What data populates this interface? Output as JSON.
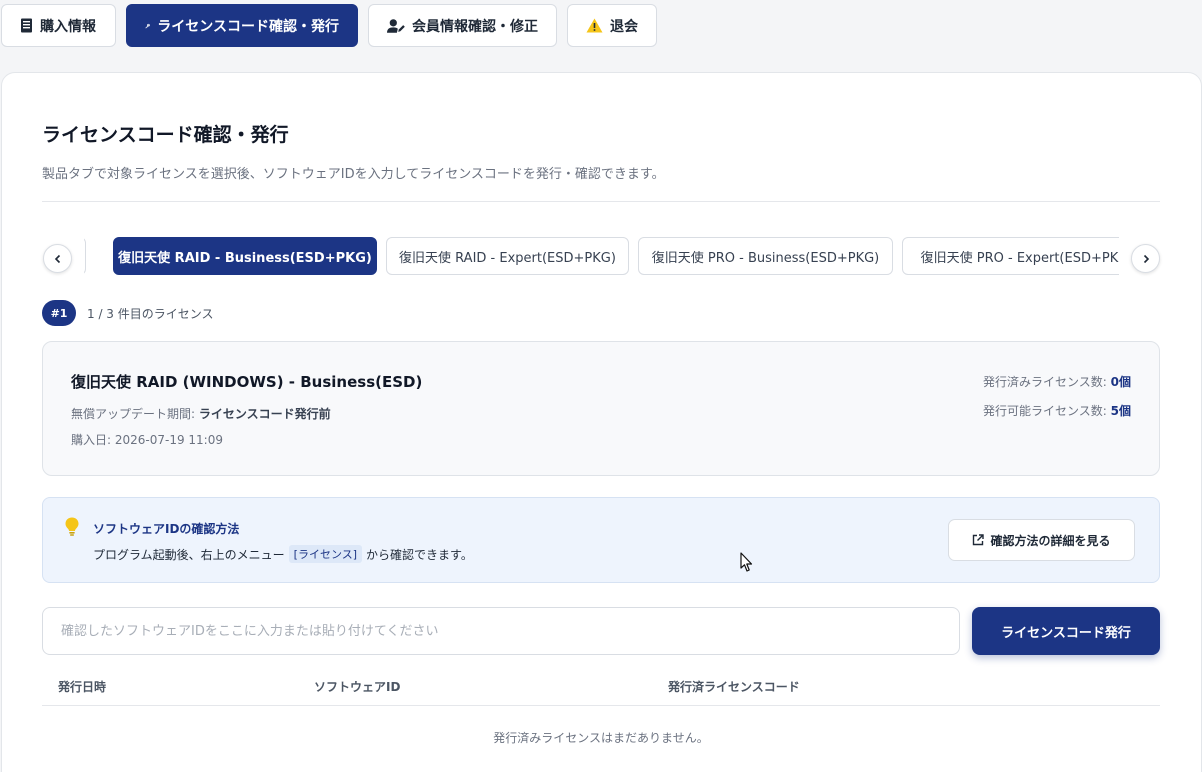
{
  "nav": {
    "tabs": [
      {
        "label": "購入情報",
        "icon": "receipt-icon",
        "active": false
      },
      {
        "label": "ライセンスコード確認・発行",
        "icon": "key-icon",
        "active": true
      },
      {
        "label": "会員情報確認・修正",
        "icon": "user-edit-icon",
        "active": false
      },
      {
        "label": "退会",
        "icon": "warning-icon",
        "active": false
      }
    ]
  },
  "page": {
    "title": "ライセンスコード確認・発行",
    "description": "製品タブで対象ライセンスを選択後、ソフトウェアIDを入力してライセンスコードを発行・確認できます。"
  },
  "product_tabs": [
    {
      "label": "復旧天使 RAID - Business(ESD+PKG)",
      "active": true
    },
    {
      "label": "復旧天使 RAID - Expert(ESD+PKG)",
      "active": false
    },
    {
      "label": "復旧天使 PRO - Business(ESD+PKG)",
      "active": false
    },
    {
      "label": "復旧天使 PRO - Expert(ESD+PKG)",
      "active": false
    }
  ],
  "license_index": {
    "badge": "#1",
    "text": "1 / 3 件目のライセンス"
  },
  "license": {
    "name": "復旧天使 RAID (WINDOWS) - Business(ESD)",
    "update_label": "無償アップデート期間: ",
    "update_value": "ライセンスコード発行前",
    "purchase_date": "購入日: 2026-07-19 11:09",
    "issued_label": "発行済みライセンス数: ",
    "issued_value": "0個",
    "available_label": "発行可能ライセンス数: ",
    "available_value": "5個"
  },
  "hint": {
    "title": "ソフトウェアIDの確認方法",
    "text_before": "プログラム起動後、右上のメニュー",
    "tag": "[ライセンス]",
    "text_after": "から確認できます。",
    "button": "確認方法の詳細を見る"
  },
  "input": {
    "value": "",
    "placeholder": "確認したソフトウェアIDをここに入力または貼り付けてください"
  },
  "issue_button": "ライセンスコード発行",
  "table": {
    "headers": [
      "発行日時",
      "ソフトウェアID",
      "発行済ライセンスコード"
    ],
    "empty_message": "発行済みライセンスはまだありません。"
  },
  "colors": {
    "primary": "#1c3585",
    "hint_bg": "#eef4fd",
    "warning": "#f5c518",
    "bulb": "#f5c518"
  }
}
